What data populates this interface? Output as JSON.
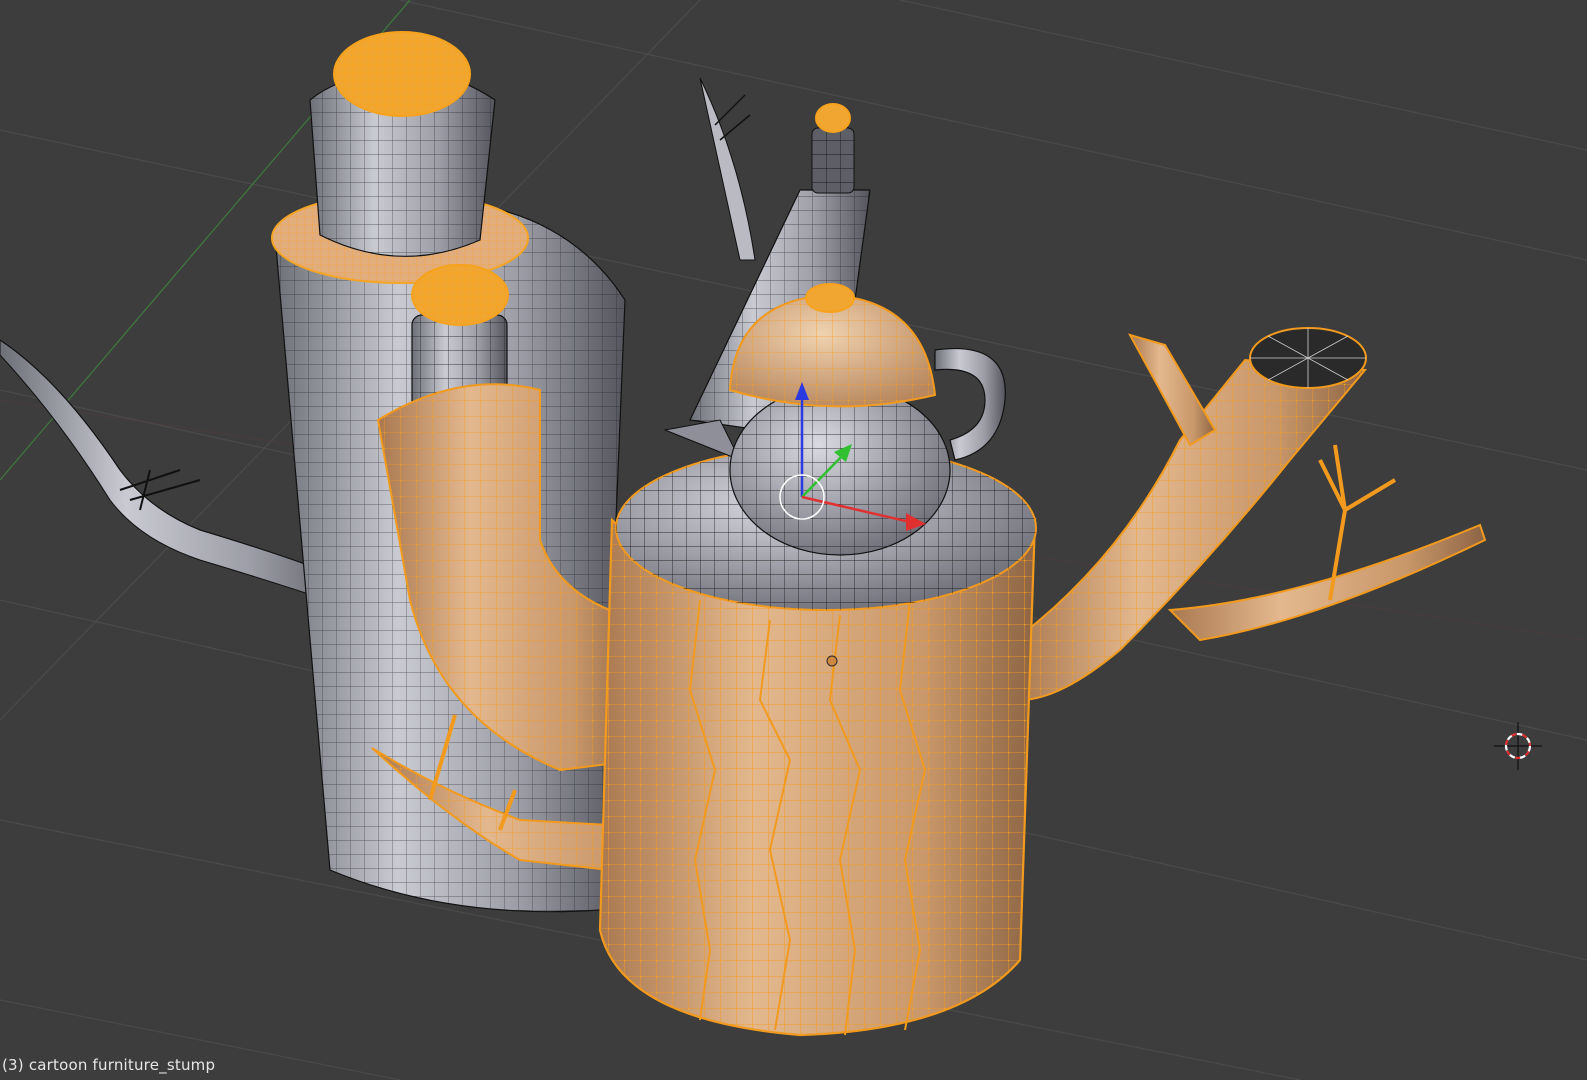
{
  "viewport": {
    "object_label": "(3) cartoon furniture_stump",
    "background": "#3d3d3d",
    "grid_color": "#4a4a4a",
    "selection_color": "#f5a524",
    "selected_face_color": "#d9a06a",
    "unselected_face_color": "#a9aab4",
    "wire_color": "#111111"
  },
  "gizmo": {
    "x_axis_color": "#e03030",
    "y_axis_color": "#30c030",
    "z_axis_color": "#2a3ae0"
  },
  "icons": {
    "cursor": "3d-cursor-icon",
    "manipulator": "transform-manipulator-icon"
  }
}
